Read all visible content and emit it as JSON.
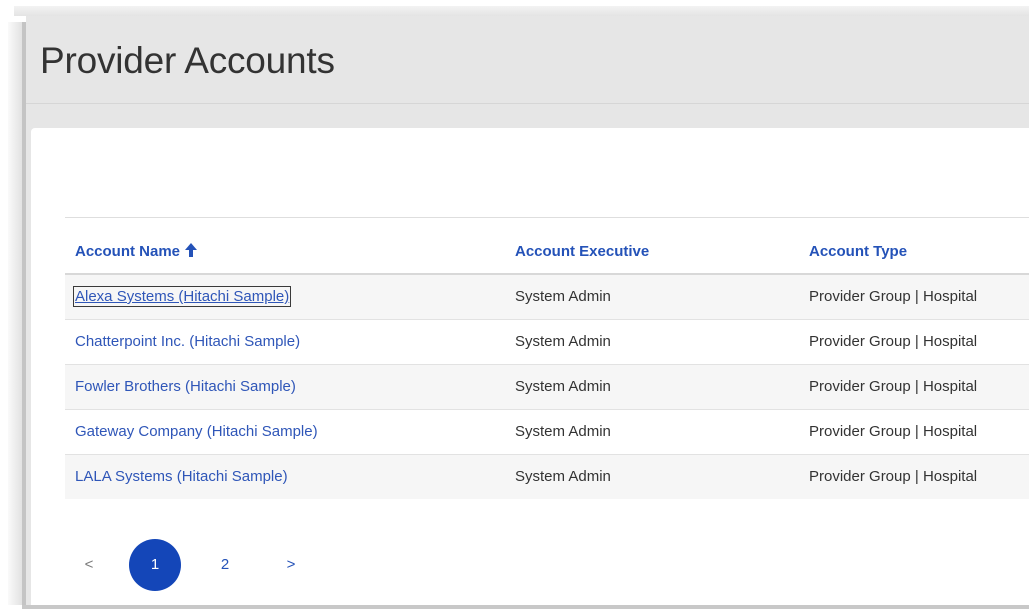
{
  "page": {
    "title": "Provider Accounts"
  },
  "table": {
    "columns": {
      "account_name": "Account Name",
      "account_executive": "Account Executive",
      "account_type": "Account Type"
    },
    "sort_icon": "arrow-up-icon",
    "rows": [
      {
        "name": "Alexa Systems (Hitachi Sample)",
        "executive": "System Admin",
        "type": "Provider Group | Hospital"
      },
      {
        "name": "Chatterpoint Inc. (Hitachi Sample)",
        "executive": "System Admin",
        "type": "Provider Group | Hospital"
      },
      {
        "name": "Fowler Brothers (Hitachi Sample)",
        "executive": "System Admin",
        "type": "Provider Group | Hospital"
      },
      {
        "name": "Gateway Company (Hitachi Sample)",
        "executive": "System Admin",
        "type": "Provider Group | Hospital"
      },
      {
        "name": "LALA Systems (Hitachi Sample)",
        "executive": "System Admin",
        "type": "Provider Group | Hospital"
      }
    ]
  },
  "pagination": {
    "prev_label": "<",
    "pages": [
      "1",
      "2"
    ],
    "current_page": "1",
    "next_label": ">"
  },
  "colors": {
    "link": "#2f56b8",
    "header": "#2452b8",
    "active_page": "#1446b8"
  }
}
